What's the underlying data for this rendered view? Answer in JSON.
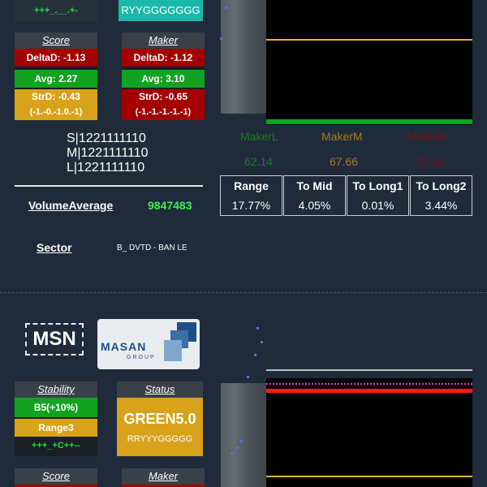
{
  "top": {
    "stability_tail": "+++_.__.+-",
    "status_tail": "RYYGGGGGGG",
    "score": {
      "header": "Score",
      "delta": "DeltaD: -1.13",
      "avg": "Avg: 2.27",
      "strd": "StrD: -0.43",
      "strd_detail": "(-1.-0.-1.0.-1)"
    },
    "maker": {
      "header": "Maker",
      "delta": "DeltaD: -1.12",
      "avg": "Avg: 3.10",
      "strd": "StrD: -0.65",
      "strd_detail": "(-1.-1.-1.-1.-1)"
    },
    "slm": [
      "S|1221111110",
      "M|1221111110",
      "L|1221111110"
    ],
    "volume": {
      "label": "VolumeAverage",
      "value": "9847483"
    },
    "sector": {
      "label": "Sector",
      "value": "B_ DVTD - BAN LE"
    },
    "makers": [
      {
        "label": "MakerL",
        "value": "62.14",
        "color": "#1f7a2a"
      },
      {
        "label": "MakerM",
        "value": "67.66",
        "color": "#a67e1a"
      },
      {
        "label": "MakerH",
        "value": "73.18",
        "color": "#7a0f0f"
      }
    ],
    "metrics": [
      {
        "header": "Range",
        "value": "17.77%"
      },
      {
        "header": "To Mid",
        "value": "4.05%"
      },
      {
        "header": "To Long1",
        "value": "0.01%"
      },
      {
        "header": "To Long2",
        "value": "3.44%"
      }
    ]
  },
  "bottom": {
    "ticker": "MSN",
    "logo": {
      "brand": "MASAN",
      "sub": "GROUP"
    },
    "stability": {
      "header": "Stability",
      "b5": "B5(+10%)",
      "range": "Range3",
      "tail": "+++_+C++--"
    },
    "status": {
      "header": "Status",
      "value": "GREEN5.0",
      "tail": "RRYYYGGGGG"
    },
    "score_header": "Score",
    "maker_header": "Maker"
  },
  "colors": {
    "background": "#1f2b3a",
    "red": "#a30000",
    "green": "#11a31f",
    "gold": "#d8a21b",
    "teal": "#1bb7a8",
    "chart_yellow": "#e6b12a",
    "chart_red": "#ff1a1a",
    "chart_magenta": "#d13de0"
  }
}
